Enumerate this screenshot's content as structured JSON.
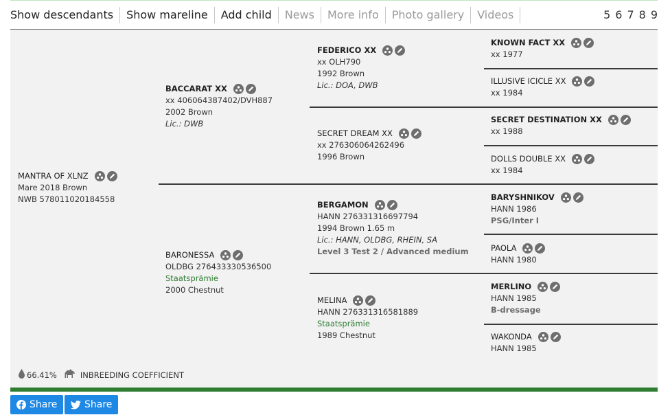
{
  "toolbar": {
    "items": [
      {
        "label": "Show descendants",
        "muted": false
      },
      {
        "label": "Show mareline",
        "muted": false
      },
      {
        "label": "Add child",
        "muted": false
      },
      {
        "label": "News",
        "muted": true
      },
      {
        "label": "More info",
        "muted": true
      },
      {
        "label": "Photo gallery",
        "muted": true
      },
      {
        "label": "Videos",
        "muted": true
      }
    ],
    "pages": [
      "5",
      "6",
      "7",
      "8",
      "9"
    ]
  },
  "horse": {
    "name": "MANTRA OF XLNZ",
    "line1": "Mare 2018 Brown",
    "line2": "NWB 578011020184558"
  },
  "gen1": {
    "sire": {
      "name": "BACCARAT XX",
      "id": "xx 406064387402/DVH887",
      "info": "2002 Brown",
      "lic": "Lic.: DWB"
    },
    "dam": {
      "name": "BARONESSA",
      "id": "OLDBG 276433330536500",
      "award": "Staatsprämie",
      "info": "2000 Chestnut"
    }
  },
  "gen2": {
    "ss": {
      "name": "FEDERICO XX",
      "id": "xx OLH790",
      "info": "1992 Brown",
      "lic": "Lic.: DOA, DWB"
    },
    "sd": {
      "name": "SECRET DREAM XX",
      "id": "xx 276306064262496",
      "info": "1996 Brown"
    },
    "ds": {
      "name": "BERGAMON",
      "id": "HANN 276331316697794",
      "info": "1994 Brown 1.65 m",
      "lic": "Lic.: HANN, OLDBG, RHEIN, SA",
      "perf": "Level 3 Test 2 / Advanced medium"
    },
    "dd": {
      "name": "MELINA",
      "id": "HANN 276331316581889",
      "award": "Staatsprämie",
      "info": "1989 Chestnut"
    }
  },
  "gen3": [
    {
      "name": "KNOWN FACT XX",
      "info": "xx 1977",
      "bold": true
    },
    {
      "name": "ILLUSIVE ICICLE XX",
      "info": "xx 1984",
      "bold": false
    },
    {
      "name": "SECRET DESTINATION XX",
      "info": "xx 1988",
      "bold": true
    },
    {
      "name": "DOLLS DOUBLE XX",
      "info": "xx 1984",
      "bold": false
    },
    {
      "name": "BARYSHNIKOV",
      "info": "HANN 1986",
      "perf": "PSG/Inter I",
      "bold": true
    },
    {
      "name": "PAOLA",
      "info": "HANN 1980",
      "bold": false
    },
    {
      "name": "MERLINO",
      "info": "HANN 1985",
      "perf": "B-dressage",
      "bold": true
    },
    {
      "name": "WAKONDA",
      "info": "HANN 1985",
      "bold": false
    }
  ],
  "inbreeding": {
    "value": "66.41%",
    "label": "INBREEDING COEFFICIENT"
  },
  "share": {
    "facebook_label": "Share",
    "twitter_label": "Share"
  },
  "colors": {
    "accent_green": "#2e7d32",
    "share_blue": "#1e88e5",
    "icon_gray": "#6e6e6e"
  },
  "icons": {
    "descendants": "people-icon",
    "edit": "pencil-icon",
    "drop": "drop-icon",
    "horse": "horse-icon"
  }
}
